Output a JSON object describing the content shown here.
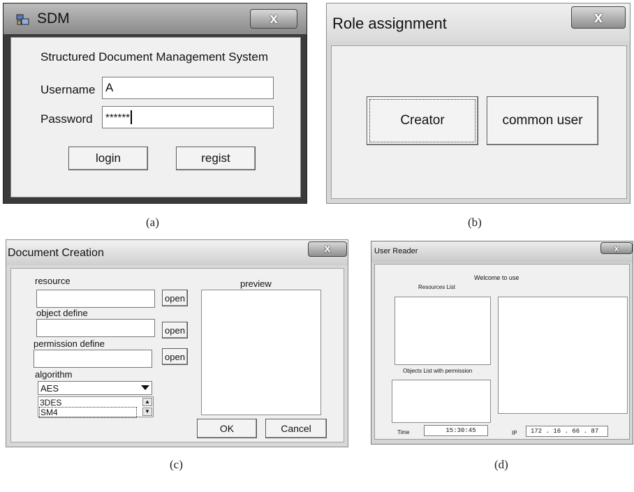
{
  "a": {
    "caption": "(a)",
    "title": "SDM",
    "close": "x",
    "header": "Structured Document Management System",
    "username_label": "Username",
    "username_value": "A",
    "password_label": "Password",
    "password_value": "******",
    "login": "login",
    "regist": "regist"
  },
  "b": {
    "caption": "(b)",
    "title": "Role assignment",
    "close": "x",
    "creator": "Creator",
    "common_user": "common user"
  },
  "c": {
    "caption": "(c)",
    "title": "Document Creation",
    "close": "x",
    "resource_label": "resource",
    "object_label": "object define",
    "permission_label": "permission define",
    "open": "open",
    "preview_label": "preview",
    "algorithm_label": "algorithm",
    "algorithm_selected": "AES",
    "algorithm_options": [
      "3DES",
      "SM4"
    ],
    "ok": "OK",
    "cancel": "Cancel"
  },
  "d": {
    "caption": "(d)",
    "title": "User Reader",
    "close": "x",
    "welcome": "Welcome to use",
    "resources_label": "Resources List",
    "objects_label": "Objects List with permission",
    "time_label": "Time",
    "time_value": "15:30:45",
    "ip_label": "IP",
    "ip_value": "172 . 16 . 66 . 87"
  },
  "icons": {
    "app": "app-icon",
    "dropdown": "dropdown-arrow-icon",
    "scroll_up": "scroll-up-icon",
    "scroll_down": "scroll-down-icon"
  }
}
